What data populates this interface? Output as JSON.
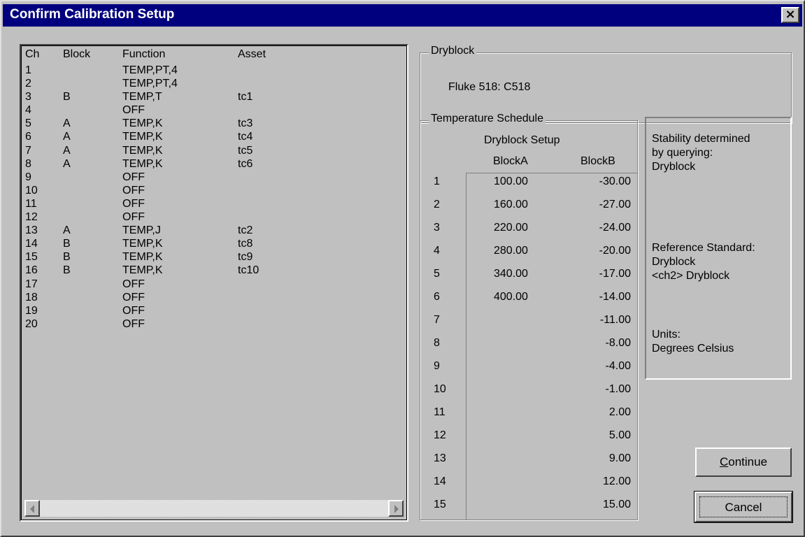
{
  "window": {
    "title": "Confirm Calibration Setup"
  },
  "channels": {
    "headers": {
      "ch": "Ch",
      "block": "Block",
      "function": "Function",
      "asset": "Asset"
    },
    "rows": [
      {
        "ch": "1",
        "block": "",
        "function": "TEMP,PT,4",
        "asset": ""
      },
      {
        "ch": "2",
        "block": "",
        "function": "TEMP,PT,4",
        "asset": ""
      },
      {
        "ch": "3",
        "block": "B",
        "function": "TEMP,T",
        "asset": "tc1"
      },
      {
        "ch": "4",
        "block": "",
        "function": "OFF",
        "asset": ""
      },
      {
        "ch": "5",
        "block": "A",
        "function": "TEMP,K",
        "asset": "tc3"
      },
      {
        "ch": "6",
        "block": "A",
        "function": "TEMP,K",
        "asset": "tc4"
      },
      {
        "ch": "7",
        "block": "A",
        "function": "TEMP,K",
        "asset": "tc5"
      },
      {
        "ch": "8",
        "block": "A",
        "function": "TEMP,K",
        "asset": "tc6"
      },
      {
        "ch": "9",
        "block": "",
        "function": "OFF",
        "asset": ""
      },
      {
        "ch": "10",
        "block": "",
        "function": "OFF",
        "asset": ""
      },
      {
        "ch": "11",
        "block": "",
        "function": "OFF",
        "asset": ""
      },
      {
        "ch": "12",
        "block": "",
        "function": "OFF",
        "asset": ""
      },
      {
        "ch": "13",
        "block": "A",
        "function": "TEMP,J",
        "asset": "tc2"
      },
      {
        "ch": "14",
        "block": "B",
        "function": "TEMP,K",
        "asset": "tc8"
      },
      {
        "ch": "15",
        "block": "B",
        "function": "TEMP,K",
        "asset": "tc9"
      },
      {
        "ch": "16",
        "block": "B",
        "function": "TEMP,K",
        "asset": "tc10"
      },
      {
        "ch": "17",
        "block": "",
        "function": "OFF",
        "asset": ""
      },
      {
        "ch": "18",
        "block": "",
        "function": "OFF",
        "asset": ""
      },
      {
        "ch": "19",
        "block": "",
        "function": "OFF",
        "asset": ""
      },
      {
        "ch": "20",
        "block": "",
        "function": "OFF",
        "asset": ""
      }
    ]
  },
  "dryblock": {
    "label": "Dryblock",
    "value": "Fluke 518: C518"
  },
  "schedule": {
    "label": "Temperature Schedule",
    "setup_heading": "Dryblock Setup",
    "col_a": "BlockA",
    "col_b": "BlockB",
    "rows": [
      {
        "n": "1",
        "a": "100.00",
        "b": "-30.00"
      },
      {
        "n": "2",
        "a": "160.00",
        "b": "-27.00"
      },
      {
        "n": "3",
        "a": "220.00",
        "b": "-24.00"
      },
      {
        "n": "4",
        "a": "280.00",
        "b": "-20.00"
      },
      {
        "n": "5",
        "a": "340.00",
        "b": "-17.00"
      },
      {
        "n": "6",
        "a": "400.00",
        "b": "-14.00"
      },
      {
        "n": "7",
        "a": "",
        "b": "-11.00"
      },
      {
        "n": "8",
        "a": "",
        "b": "-8.00"
      },
      {
        "n": "9",
        "a": "",
        "b": "-4.00"
      },
      {
        "n": "10",
        "a": "",
        "b": "-1.00"
      },
      {
        "n": "11",
        "a": "",
        "b": "2.00"
      },
      {
        "n": "12",
        "a": "",
        "b": "5.00"
      },
      {
        "n": "13",
        "a": "",
        "b": "9.00"
      },
      {
        "n": "14",
        "a": "",
        "b": "12.00"
      },
      {
        "n": "15",
        "a": "",
        "b": "15.00"
      }
    ]
  },
  "info": {
    "stability_1": "Stability determined",
    "stability_2": "by querying:",
    "stability_3": "Dryblock",
    "ref_1": "Reference Standard:",
    "ref_2": "Dryblock",
    "ref_3": "<ch2> Dryblock",
    "units_1": "Units:",
    "units_2": "Degrees Celsius"
  },
  "buttons": {
    "continue_prefix": "C",
    "continue_rest": "ontinue",
    "cancel": "Cancel"
  }
}
